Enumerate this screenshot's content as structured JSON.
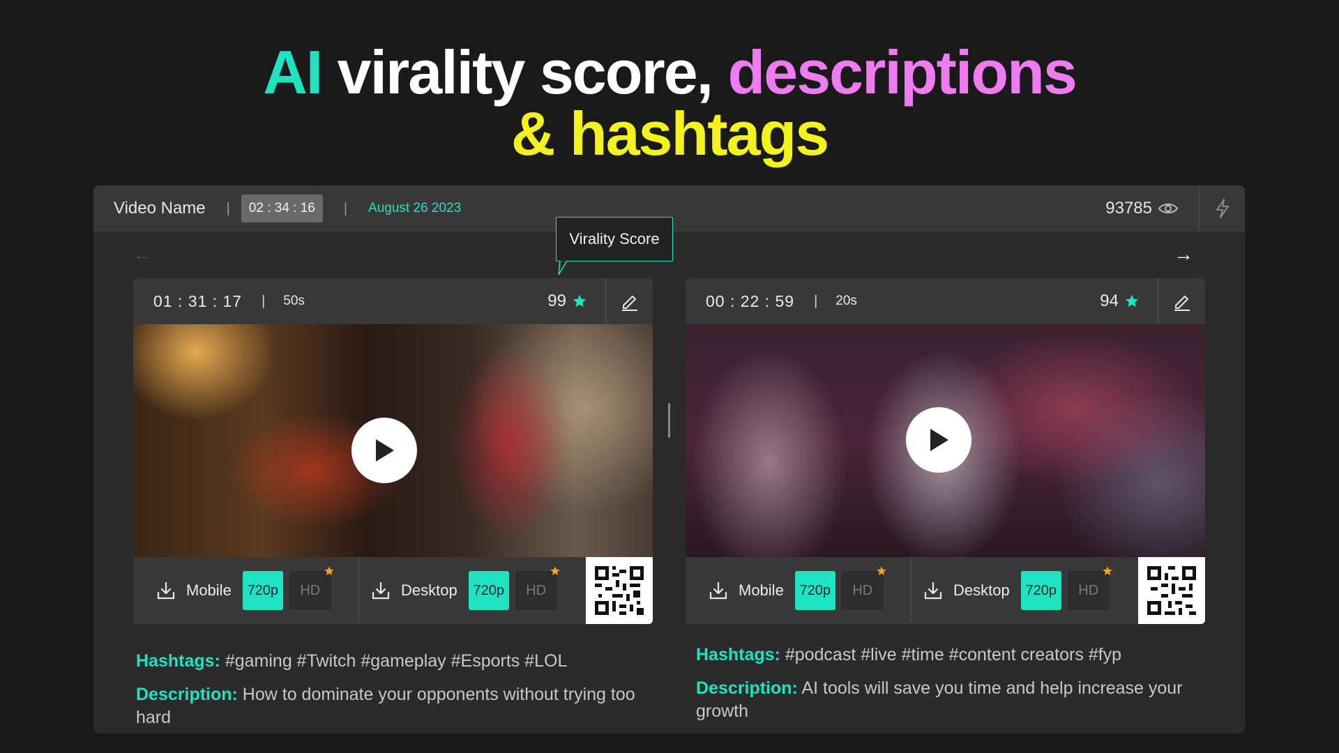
{
  "headline": {
    "part_ai": "AI",
    "part_virality": " virality score, ",
    "part_descriptions": "descriptions",
    "part_hashtags": "& hashtags"
  },
  "colors": {
    "accent_teal": "#1ee3c3",
    "accent_pink": "#ef7bf0",
    "accent_yellow": "#f4f21b",
    "star_orange": "#f7a21b"
  },
  "topbar": {
    "video_name": "Video Name",
    "separator": "|",
    "timecode": "02 : 34 : 16",
    "date": "August  26 2023",
    "views": "93785",
    "views_icon": "eye-icon",
    "action_icon": "lightning-icon"
  },
  "nav": {
    "prev": "←",
    "next": "→"
  },
  "tooltip": {
    "label": "Virality Score"
  },
  "clips": [
    {
      "timecode": "01 : 31 : 17",
      "separator": "|",
      "duration": "50s",
      "score": "99",
      "score_icon": "star-icon",
      "edit_icon": "pencil-icon",
      "downloads": [
        {
          "label": "Mobile",
          "q1": "720p",
          "q2": "HD"
        },
        {
          "label": "Desktop",
          "q1": "720p",
          "q2": "HD"
        }
      ],
      "hashtags_label": "Hashtags:",
      "hashtags": " #gaming #Twitch #gameplay #Esports #LOL",
      "description_label": "Description:",
      "description": " How to dominate your opponents without trying too hard"
    },
    {
      "timecode": "00 : 22 : 59",
      "separator": "|",
      "duration": "20s",
      "score": "94",
      "score_icon": "star-icon",
      "edit_icon": "pencil-icon",
      "downloads": [
        {
          "label": "Mobile",
          "q1": "720p",
          "q2": "HD"
        },
        {
          "label": "Desktop",
          "q1": "720p",
          "q2": "HD"
        }
      ],
      "hashtags_label": "Hashtags:",
      "hashtags": " #podcast #live #time #content creators #fyp",
      "description_label": "Description:",
      "description": " AI tools will save you time and help increase your growth"
    }
  ]
}
